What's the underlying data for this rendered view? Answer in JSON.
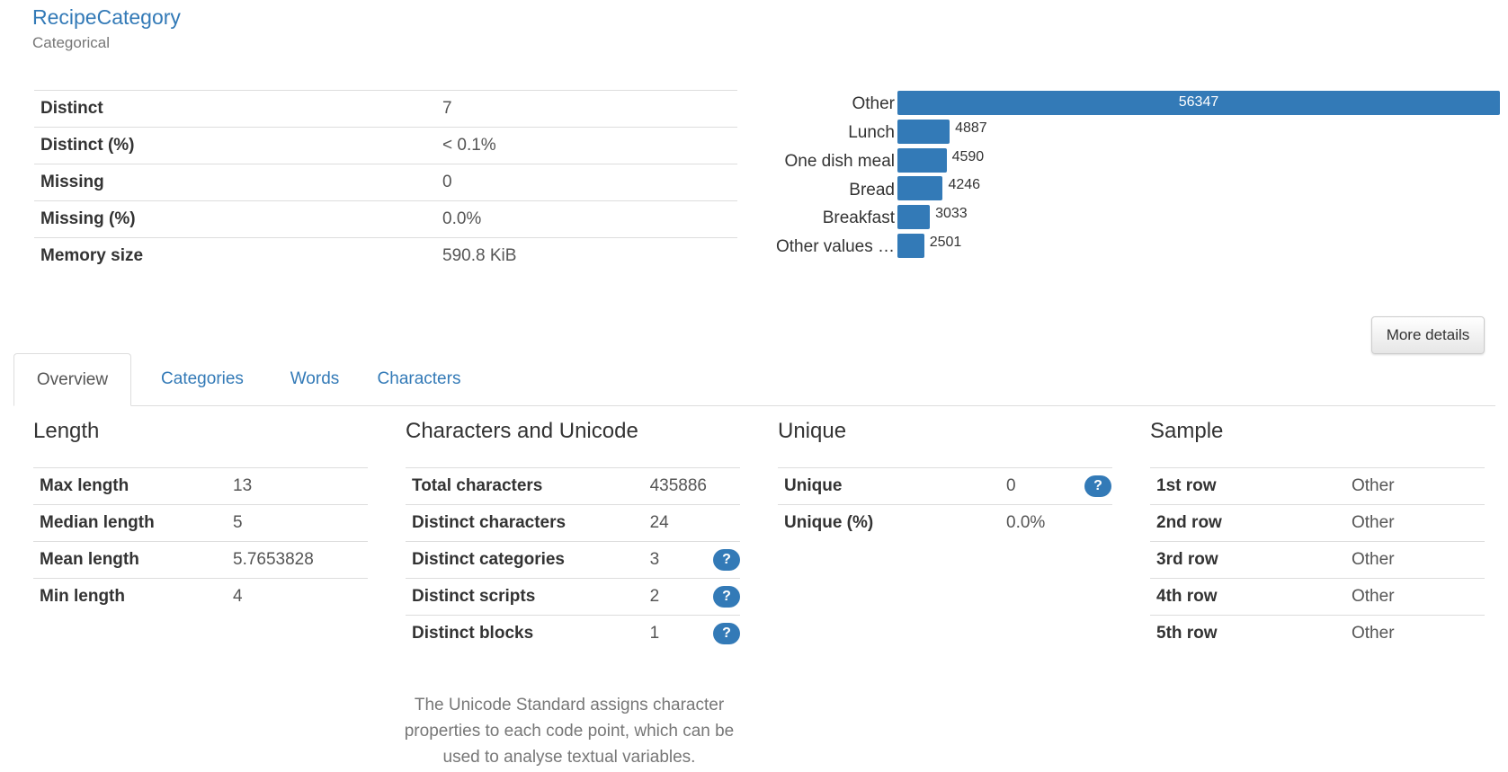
{
  "header": {
    "title": "RecipeCategory",
    "subtitle": "Categorical"
  },
  "stats": [
    {
      "key": "Distinct",
      "value": "7"
    },
    {
      "key": "Distinct (%)",
      "value": "< 0.1%"
    },
    {
      "key": "Missing",
      "value": "0"
    },
    {
      "key": "Missing (%)",
      "value": "0.0%"
    },
    {
      "key": "Memory size",
      "value": "590.8 KiB"
    }
  ],
  "chart_data": {
    "type": "bar",
    "orientation": "horizontal",
    "categories": [
      "Other",
      "Lunch",
      "One dish meal",
      "Bread",
      "Breakfast",
      "Other values …"
    ],
    "values": [
      56347,
      4887,
      4590,
      4246,
      3033,
      2501
    ],
    "value_labels": [
      "56347",
      "4887",
      "4590",
      "4246",
      "3033",
      "2501"
    ],
    "bar_color": "#337ab7"
  },
  "more_details_button": "More details",
  "tabs": [
    {
      "label": "Overview",
      "active": true
    },
    {
      "label": "Categories",
      "active": false
    },
    {
      "label": "Words",
      "active": false
    },
    {
      "label": "Characters",
      "active": false
    }
  ],
  "length": {
    "title": "Length",
    "rows": [
      {
        "key": "Max length",
        "value": "13"
      },
      {
        "key": "Median length",
        "value": "5"
      },
      {
        "key": "Mean length",
        "value": "5.7653828"
      },
      {
        "key": "Min length",
        "value": "4"
      }
    ]
  },
  "unicode": {
    "title": "Characters and Unicode",
    "rows": [
      {
        "key": "Total characters",
        "value": "435886",
        "help": false
      },
      {
        "key": "Distinct characters",
        "value": "24",
        "help": false
      },
      {
        "key": "Distinct categories",
        "value": "3",
        "help": true
      },
      {
        "key": "Distinct scripts",
        "value": "2",
        "help": true
      },
      {
        "key": "Distinct blocks",
        "value": "1",
        "help": true
      }
    ],
    "note": "The Unicode Standard assigns character properties to each code point, which can be used to analyse textual variables.",
    "help_glyph": "?"
  },
  "unique": {
    "title": "Unique",
    "rows": [
      {
        "key": "Unique",
        "value": "0",
        "help": true
      },
      {
        "key": "Unique (%)",
        "value": "0.0%",
        "help": false
      }
    ]
  },
  "sample": {
    "title": "Sample",
    "rows": [
      {
        "key": "1st row",
        "value": "Other"
      },
      {
        "key": "2nd row",
        "value": "Other"
      },
      {
        "key": "3rd row",
        "value": "Other"
      },
      {
        "key": "4th row",
        "value": "Other"
      },
      {
        "key": "5th row",
        "value": "Other"
      }
    ]
  }
}
